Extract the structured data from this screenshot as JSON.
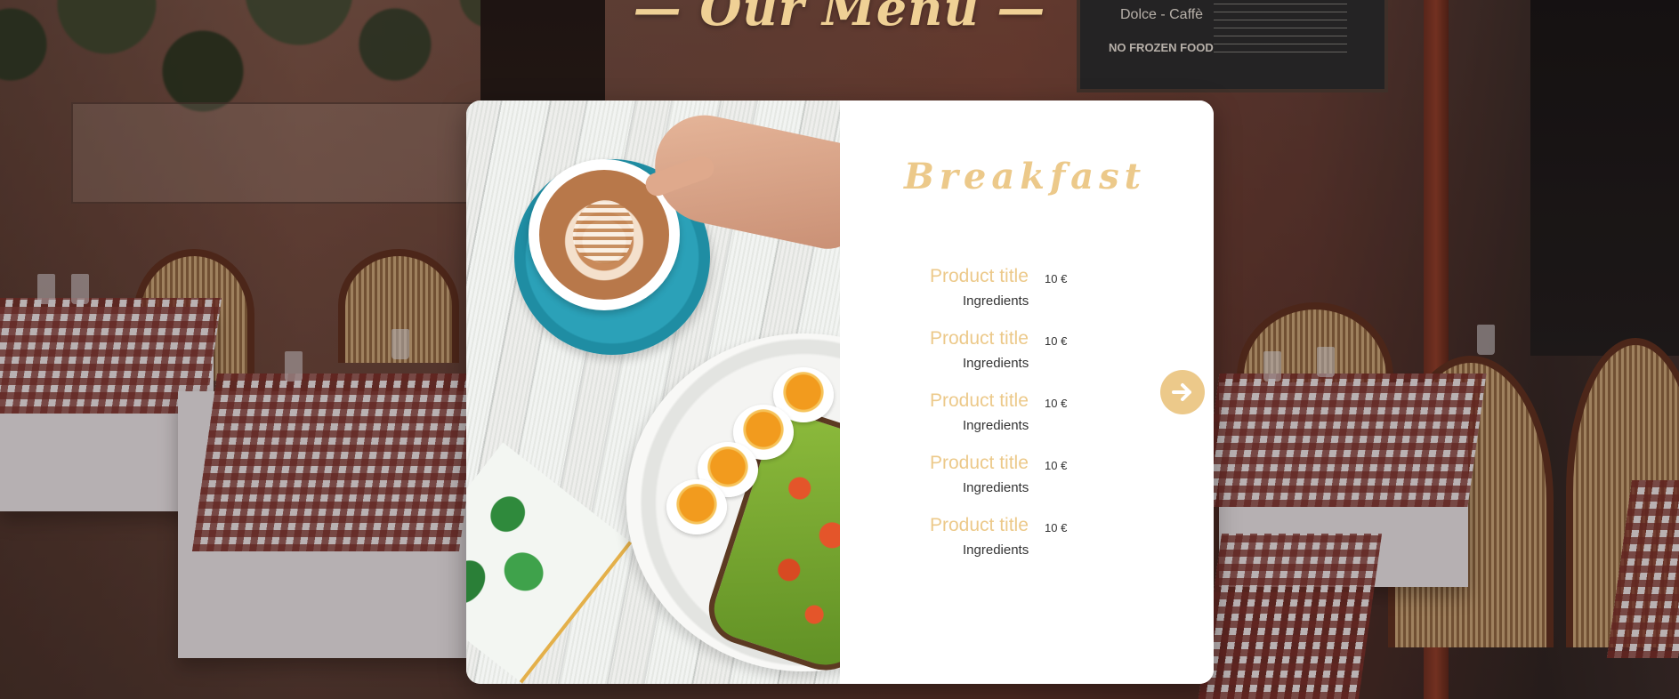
{
  "page": {
    "heading": "— Our Menu —"
  },
  "background": {
    "chalkboard_line_1": "Dolce - Caffè",
    "chalkboard_line_2": "NO FROZEN FOOD"
  },
  "menu": {
    "category": "Breakfast",
    "items": [
      {
        "title": "Product title",
        "price": "10 €",
        "ingredients": "Ingredients"
      },
      {
        "title": "Product title",
        "price": "10 €",
        "ingredients": "Ingredients"
      },
      {
        "title": "Product title",
        "price": "10 €",
        "ingredients": "Ingredients"
      },
      {
        "title": "Product title",
        "price": "10 €",
        "ingredients": "Ingredients"
      },
      {
        "title": "Product title",
        "price": "10 €",
        "ingredients": "Ingredients"
      }
    ],
    "next_icon": "arrow-right-circle-icon"
  },
  "colors": {
    "accent_gold": "#ecc98a",
    "card_background": "#ffffff",
    "text_dark": "#333333"
  }
}
